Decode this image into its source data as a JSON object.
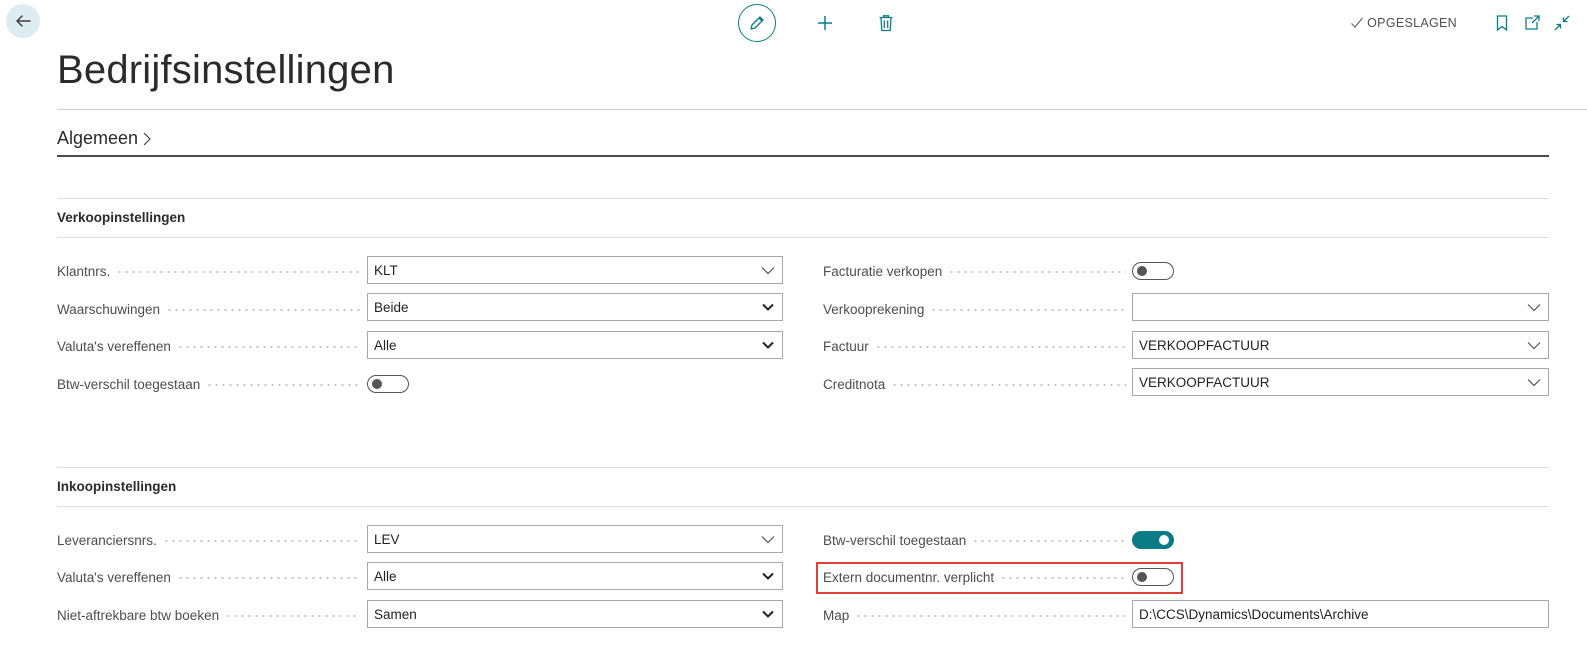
{
  "toolbar": {
    "saved_label": "OPGESLAGEN",
    "icons": {
      "back": "back-arrow-icon",
      "edit": "pencil-icon",
      "new": "plus-icon",
      "delete": "trash-icon",
      "saved": "checkmark-icon",
      "bookmark": "bookmark-icon",
      "open_new_window": "open-new-window-icon",
      "collapse": "collapse-icon"
    }
  },
  "page": {
    "title": "Bedrijfsinstellingen"
  },
  "section": {
    "title": "Algemeen"
  },
  "sales": {
    "title": "Verkoopinstellingen",
    "customer_nos": {
      "label": "Klantnrs.",
      "value": "KLT"
    },
    "warnings": {
      "label": "Waarschuwingen",
      "value": "Beide"
    },
    "appln_currency": {
      "label": "Valuta's vereffenen",
      "value": "Alle"
    },
    "vat_diff_allowed": {
      "label": "Btw-verschil toegestaan",
      "value": false
    },
    "invoice_sales": {
      "label": "Facturatie verkopen",
      "value": false
    },
    "sales_account": {
      "label": "Verkooprekening",
      "value": ""
    },
    "invoice": {
      "label": "Factuur",
      "value": "VERKOOPFACTUUR"
    },
    "credit_memo": {
      "label": "Creditnota",
      "value": "VERKOOPFACTUUR"
    }
  },
  "purchase": {
    "title": "Inkoopinstellingen",
    "vendor_nos": {
      "label": "Leveranciersnrs.",
      "value": "LEV"
    },
    "appln_currency": {
      "label": "Valuta's vereffenen",
      "value": "Alle"
    },
    "nondeductible_vat": {
      "label": "Niet-aftrekbare btw boeken",
      "value": "Samen"
    },
    "vat_diff_allowed": {
      "label": "Btw-verschil toegestaan",
      "value": true
    },
    "ext_doc_required": {
      "label": "Extern documentnr. verplicht",
      "value": false
    },
    "folder": {
      "label": "Map",
      "value": "D:\\CCS\\Dynamics\\Documents\\Archive"
    }
  },
  "colors": {
    "accent": "#0b7c86",
    "highlight": "#e0403b",
    "back_button_bg": "#dcecf0"
  }
}
